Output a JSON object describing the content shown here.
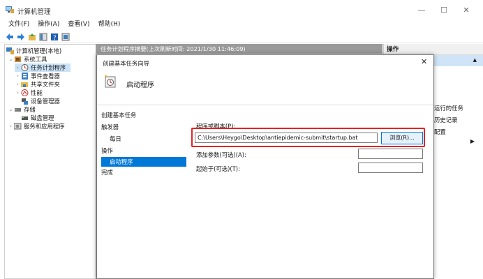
{
  "window": {
    "title": "计算机管理",
    "minimize": "—",
    "maximize": "☐",
    "close": "✕"
  },
  "menu": [
    "文件(F)",
    "操作(A)",
    "查看(V)",
    "帮助(H)"
  ],
  "tree": {
    "root": "计算机管理(本地)",
    "system_tools": "系统工具",
    "task_scheduler": "任务计划程序",
    "event_viewer": "事件查看器",
    "shared_folders": "共享文件夹",
    "performance": "性能",
    "device_manager": "设备管理器",
    "storage": "存储",
    "disk_management": "磁盘管理",
    "services": "服务和应用程序"
  },
  "center_header": "任务计划程序摘要(上次刷新时间: 2021/1/30 11:46:09)",
  "actions": {
    "header": "操作",
    "items": [
      "运行的任务",
      "历史记录",
      "配置"
    ]
  },
  "dialog": {
    "title": "创建基本任务向导",
    "close": "✕",
    "heading": "启动程序",
    "steps": {
      "create": "创建基本任务",
      "trigger": "触发器",
      "daily": "每日",
      "action": "操作",
      "start_program": "启动程序",
      "finish": "完成"
    },
    "form": {
      "program_label": "程序或脚本(P):",
      "program_value": "C:\\Users\\Heygo\\Desktop\\antiepidemic-submit\\startup.bat",
      "browse_label": "浏览(R)...",
      "args_label": "添加参数(可选)(A):",
      "args_value": "",
      "start_label": "起始于(可选)(T):",
      "start_value": ""
    }
  },
  "colors": {
    "selection": "#0078d7",
    "highlight": "#e02424",
    "header_gray": "#9a9a9a"
  }
}
